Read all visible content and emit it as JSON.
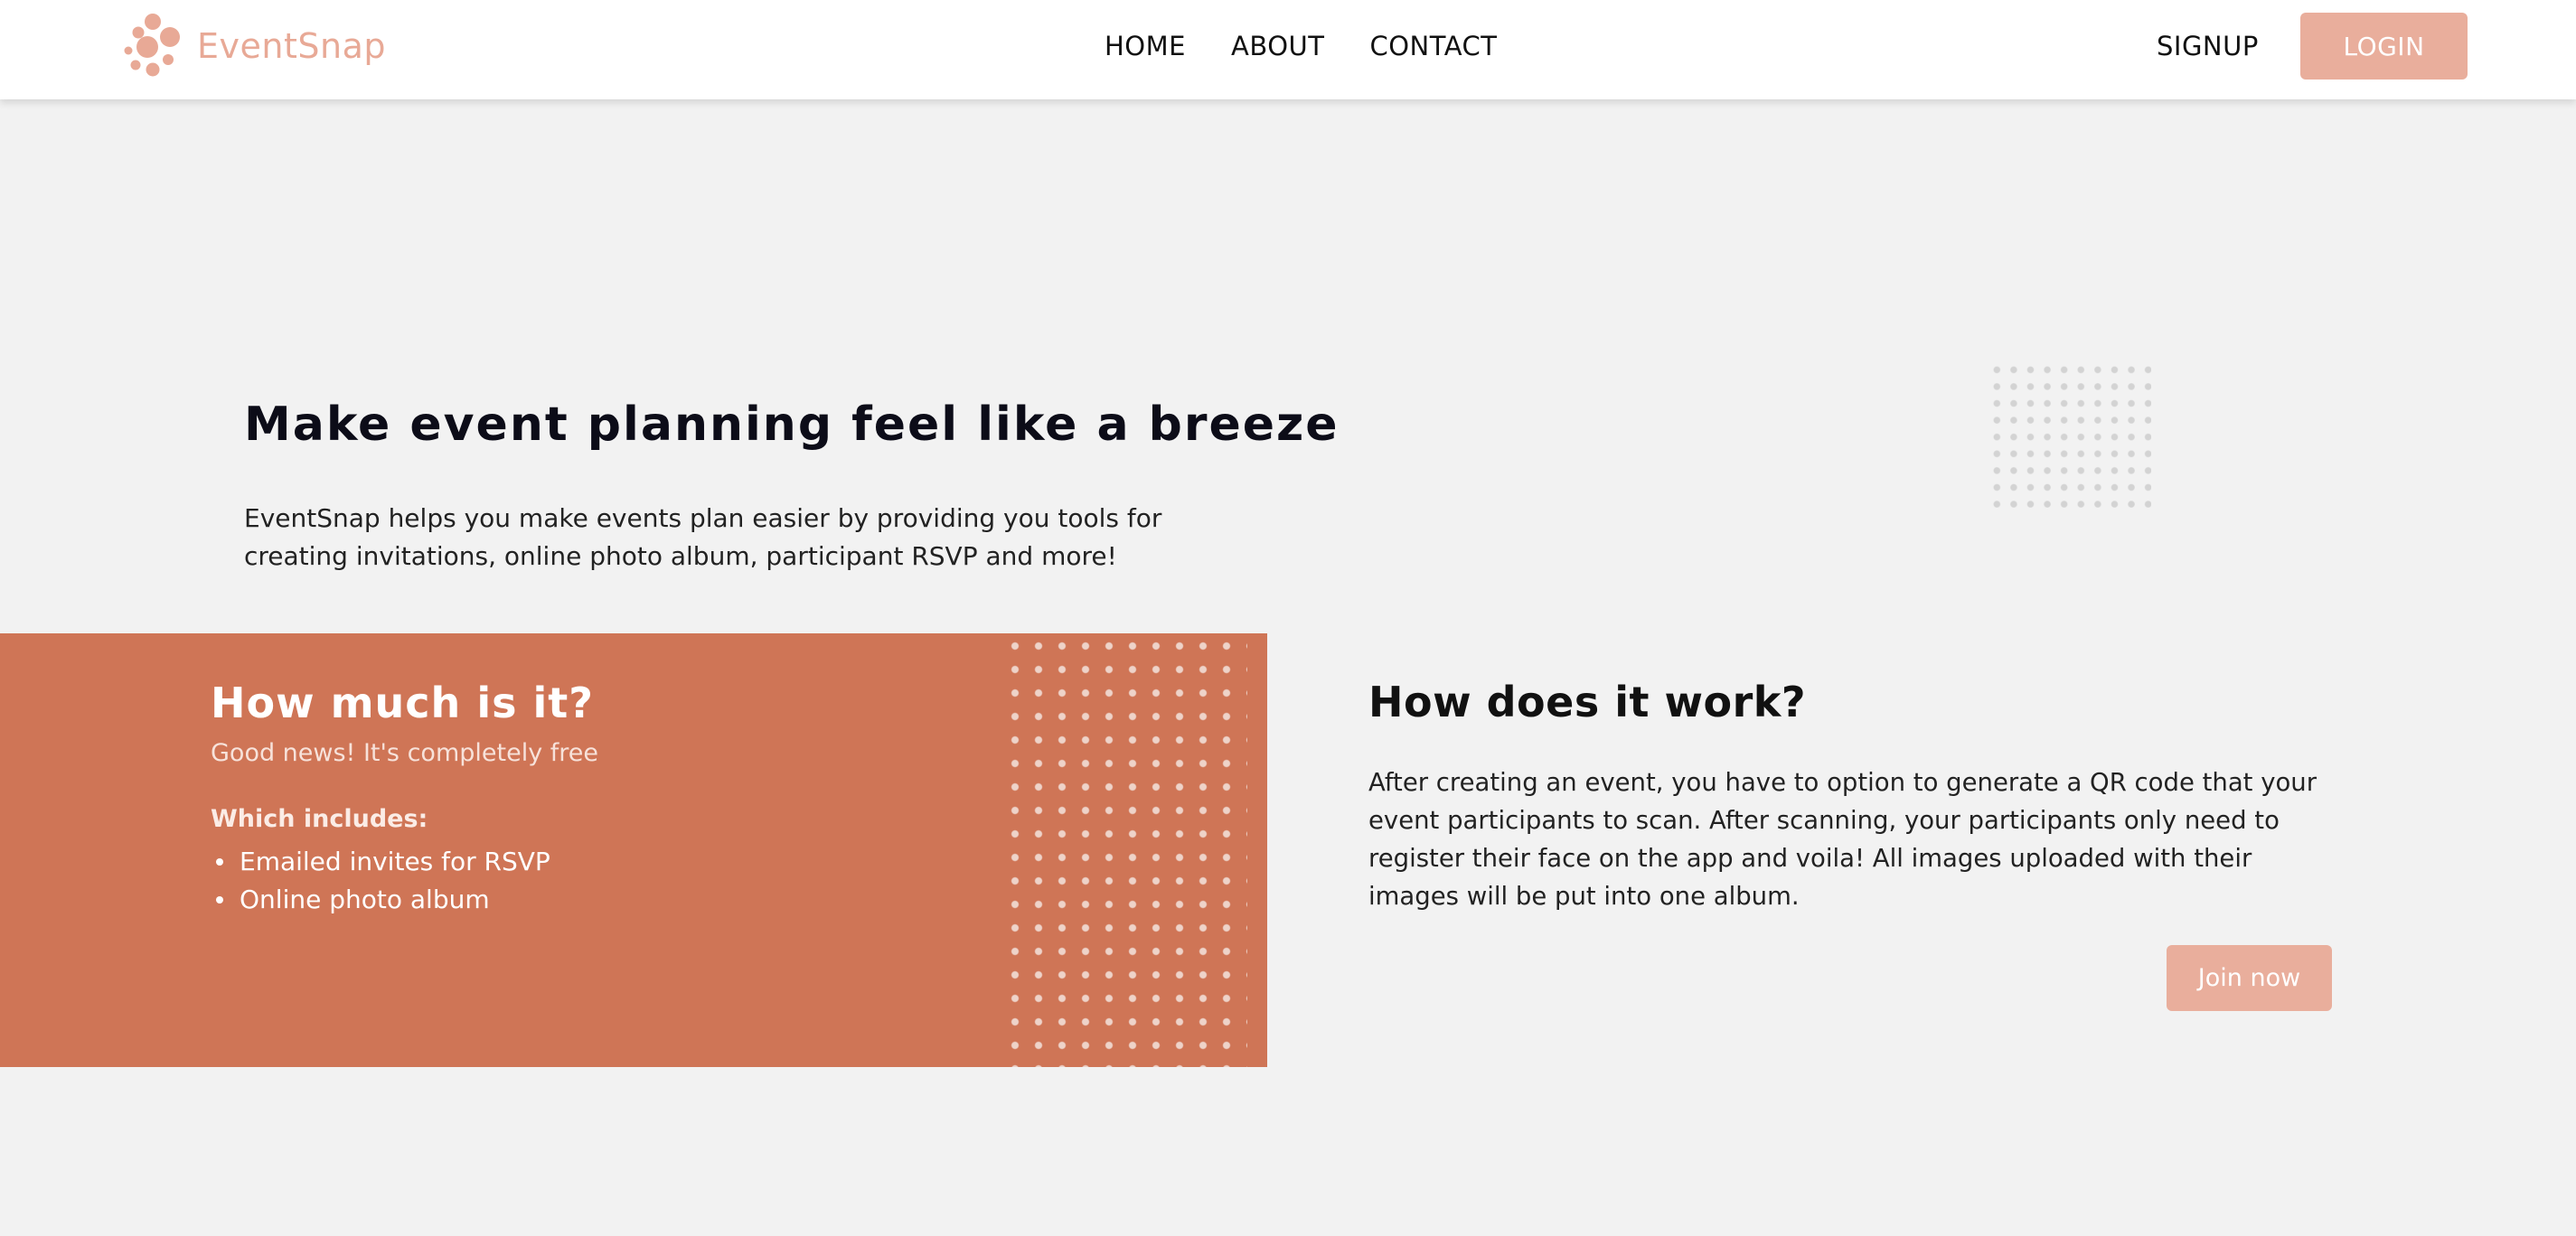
{
  "header": {
    "brand_name": "EventSnap",
    "nav": [
      {
        "label": "HOME"
      },
      {
        "label": "ABOUT"
      },
      {
        "label": "CONTACT"
      }
    ],
    "signup_label": "SIGNUP",
    "login_label": "LOGIN"
  },
  "hero": {
    "title": "Make event planning feel like a breeze",
    "description": "EventSnap helps you make events plan easier by providing you tools for creating invitations, online photo album, participant RSVP and more!"
  },
  "pricing": {
    "title": "How much is it?",
    "subtitle": "Good news! It's completely free",
    "includes_label": "Which includes:",
    "items": [
      "Emailed invites for RSVP",
      "Online photo album"
    ]
  },
  "how_it_works": {
    "title": "How does it work?",
    "description": "After creating an event, you have to option to generate a QR code that your event participants to scan. After scanning, your participants only need to register their face on the app and voila! All images uploaded with their images will be put into one album.",
    "cta_label": "Join now"
  },
  "colors": {
    "accent": "#e9ae9c",
    "panel": "#cf7556",
    "background": "#f2f2f2"
  },
  "icons": {
    "logo": "bubbles-logo-icon",
    "bullet": "bullet-dot-icon",
    "pattern": "dot-grid-pattern"
  }
}
